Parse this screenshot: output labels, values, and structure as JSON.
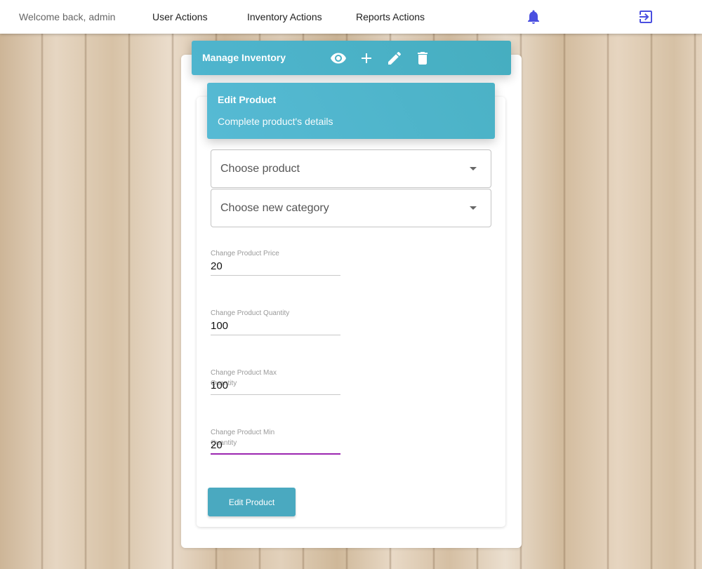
{
  "nav": {
    "welcome": "Welcome back, admin",
    "user_actions": "User Actions",
    "inventory_actions": "Inventory Actions",
    "reports_actions": "Reports Actions",
    "icons": [
      "bell-icon",
      "logout-icon"
    ],
    "icon_color": "#4a4fe0"
  },
  "manage": {
    "title": "Manage Inventory",
    "icons": [
      "eye-icon",
      "plus-icon",
      "pencil-icon",
      "trash-icon"
    ]
  },
  "form": {
    "title": "Edit Product",
    "subtitle": "Complete product's details",
    "product_select": "Choose product",
    "category_select": "Choose new category",
    "fields": [
      {
        "label": "Change Product Price",
        "value": "20"
      },
      {
        "label": "Change Product Quantity",
        "value": "100"
      },
      {
        "label": "Change Product Max Quantity",
        "value": "100"
      },
      {
        "label": "Change Product Min Quantity",
        "value": "20"
      }
    ],
    "submit_label": "Edit Product"
  },
  "colors": {
    "accent": "#4fb5ce",
    "focus_underline": "#9c27b0",
    "button": "#4aa9c0"
  }
}
